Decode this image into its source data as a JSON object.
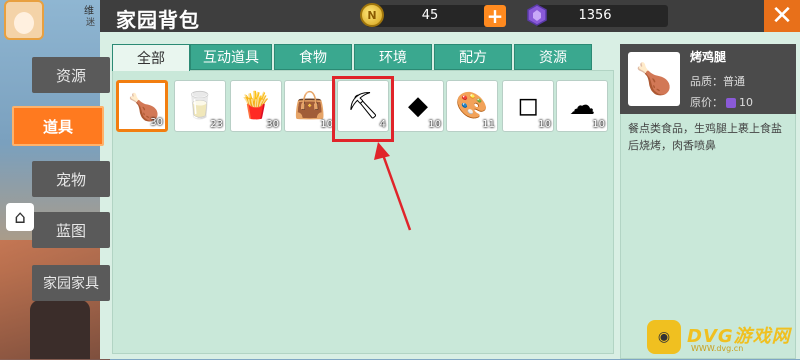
{
  "window": {
    "title": "家园背包"
  },
  "currency": {
    "coins": "45",
    "gems": "1356"
  },
  "profile": {
    "label1": "维",
    "label2": "迷"
  },
  "side_tabs": [
    {
      "label": "资源",
      "active": false
    },
    {
      "label": "道具",
      "active": true
    },
    {
      "label": "宠物",
      "active": false
    },
    {
      "label": "蓝图",
      "active": false
    },
    {
      "label": "家园家具",
      "active": false
    }
  ],
  "category_tabs": [
    {
      "label": "全部",
      "active": true
    },
    {
      "label": "互动道具",
      "active": false
    },
    {
      "label": "食物",
      "active": false
    },
    {
      "label": "环境",
      "active": false
    },
    {
      "label": "配方",
      "active": false
    },
    {
      "label": "资源",
      "active": false
    }
  ],
  "items": [
    {
      "icon": "roast-drumstick-icon",
      "count": "30",
      "selected": true
    },
    {
      "icon": "milk-carton-icon",
      "count": "23",
      "selected": false
    },
    {
      "icon": "fries-icon",
      "count": "30",
      "selected": false
    },
    {
      "icon": "sack-icon",
      "count": "10",
      "selected": false
    },
    {
      "icon": "pickaxe-icon",
      "count": "4",
      "selected": false
    },
    {
      "icon": "coal-icon",
      "count": "10",
      "selected": false
    },
    {
      "icon": "paint-palette-icon",
      "count": "11",
      "selected": false
    },
    {
      "icon": "sugar-cubes-icon",
      "count": "10",
      "selected": false
    },
    {
      "icon": "flour-bag-icon",
      "count": "10",
      "selected": false
    }
  ],
  "detail": {
    "name": "烤鸡腿",
    "quality_label": "品质：",
    "quality": "普通",
    "price_label": "原价：",
    "price": "10",
    "description": "餐点类食品，生鸡腿上裹上食盐后烧烤，肉香喷鼻"
  },
  "watermark": {
    "text": "DVG游戏网",
    "sub": "WWW.dvg.cn"
  },
  "colors": {
    "accent": "#ff7a1f",
    "tab": "#3aa88f",
    "highlight": "#e0242a"
  }
}
